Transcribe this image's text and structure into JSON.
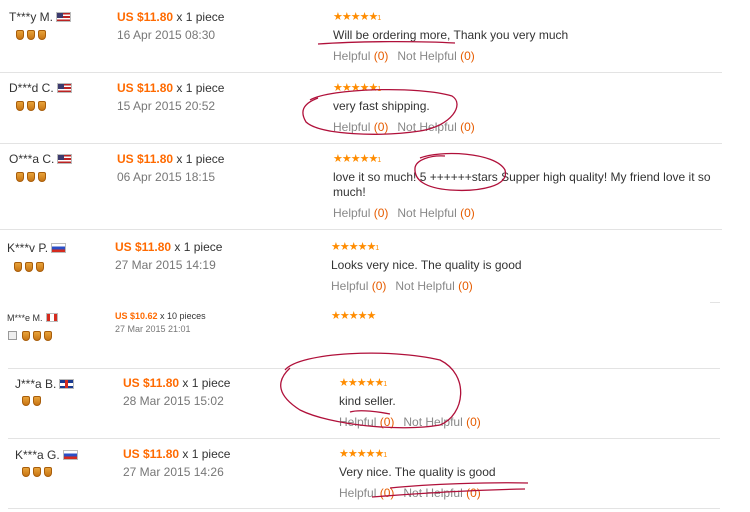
{
  "reviews": [
    {
      "buyer": "T***y M.",
      "flag": "us",
      "price": "US $11.80",
      "qty": "x 1 piece",
      "date": "16 Apr 2015 08:30",
      "stars": "★★★★★",
      "text": "Will be ordering more, Thank you very much",
      "helpful_label": "Helpful",
      "helpful_count": "(0)",
      "not_helpful_label": "Not Helpful",
      "not_helpful_count": "(0)"
    },
    {
      "buyer": "D***d C.",
      "flag": "us",
      "price": "US $11.80",
      "qty": "x 1 piece",
      "date": "15 Apr 2015 20:52",
      "stars": "★★★★★",
      "text": "very fast shipping.",
      "helpful_label": "Helpful",
      "helpful_count": "(0)",
      "not_helpful_label": "Not Helpful",
      "not_helpful_count": "(0)"
    },
    {
      "buyer": "O***a C.",
      "flag": "us",
      "price": "US $11.80",
      "qty": "x 1 piece",
      "date": "06 Apr 2015 18:15",
      "stars": "★★★★★",
      "text": "love it so much! 5 ++++++stars Supper high quality! My friend love it so much!",
      "helpful_label": "Helpful",
      "helpful_count": "(0)",
      "not_helpful_label": "Not Helpful",
      "not_helpful_count": "(0)"
    },
    {
      "buyer": "K***v P.",
      "flag": "ru",
      "price": "US $11.80",
      "qty": "x 1 piece",
      "date": "27 Mar 2015 14:19",
      "stars": "★★★★★",
      "text": "Looks very nice. The quality is good",
      "helpful_label": "Helpful",
      "helpful_count": "(0)",
      "not_helpful_label": "Not Helpful",
      "not_helpful_count": "(0)"
    },
    {
      "buyer": "M***e M.",
      "flag": "ca",
      "price": "US $10.62",
      "qty": "x 10 pieces",
      "date": "27 Mar 2015 21:01",
      "stars": "★★★★★"
    },
    {
      "buyer": "J***a B.",
      "flag": "uk",
      "price": "US $11.80",
      "qty": "x 1 piece",
      "date": "28 Mar 2015 15:02",
      "stars": "★★★★★",
      "text": "kind seller.",
      "helpful_label": "Helpful",
      "helpful_count": "(0)",
      "not_helpful_label": "Not Helpful",
      "not_helpful_count": "(0)"
    },
    {
      "buyer": "K***a G.",
      "flag": "ru",
      "price": "US $11.80",
      "qty": "x 1 piece",
      "date": "27 Mar 2015 14:26",
      "stars": "★★★★★",
      "text": "Very nice. The quality is good",
      "helpful_label": "Helpful",
      "helpful_count": "(0)",
      "not_helpful_label": "Not Helpful",
      "not_helpful_count": "(0)"
    }
  ],
  "colors": {
    "price": "#ff6a00",
    "stars": "#ff8c00",
    "annotation": "#b0103a",
    "separator": "#e3e3e3"
  },
  "icons": {
    "star": "star-icon",
    "flag": "country-flag-icon",
    "medal": "buyer-level-medal-icon",
    "thumb": "thumbnail-icon"
  }
}
